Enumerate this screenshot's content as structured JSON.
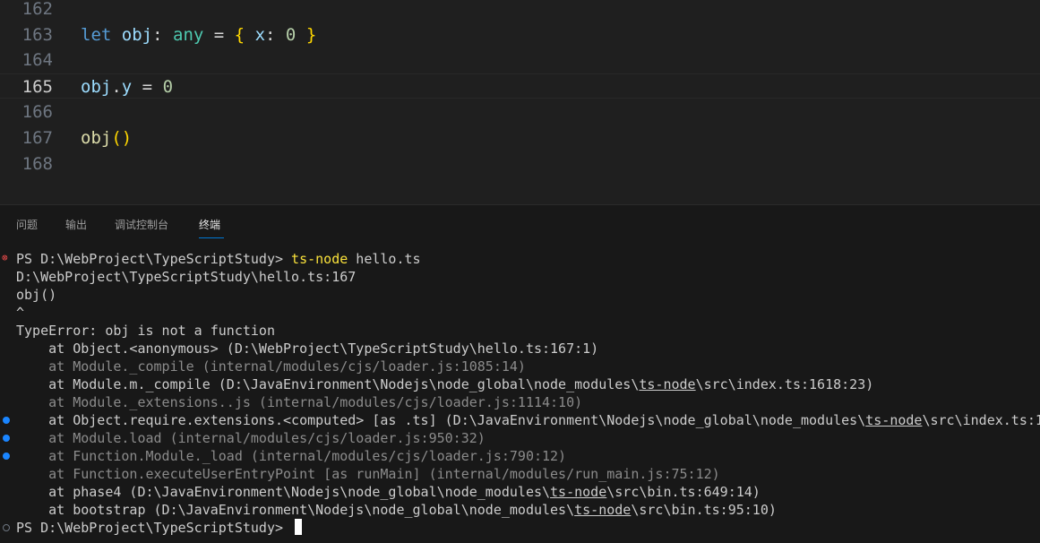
{
  "editor": {
    "lines": [
      {
        "num": "162",
        "tokens": []
      },
      {
        "num": "163",
        "tokens": [
          {
            "t": "let",
            "c": "kw"
          },
          {
            "t": " ",
            "c": "op"
          },
          {
            "t": "obj",
            "c": "var"
          },
          {
            "t": ": ",
            "c": "op"
          },
          {
            "t": "any",
            "c": "type"
          },
          {
            "t": " = ",
            "c": "op"
          },
          {
            "t": "{",
            "c": "brace"
          },
          {
            "t": " ",
            "c": "op"
          },
          {
            "t": "x",
            "c": "var"
          },
          {
            "t": ": ",
            "c": "op"
          },
          {
            "t": "0",
            "c": "num"
          },
          {
            "t": " ",
            "c": "op"
          },
          {
            "t": "}",
            "c": "brace"
          }
        ]
      },
      {
        "num": "164",
        "tokens": []
      },
      {
        "num": "165",
        "tokens": [
          {
            "t": "obj",
            "c": "var"
          },
          {
            "t": ".",
            "c": "op"
          },
          {
            "t": "y",
            "c": "var"
          },
          {
            "t": " = ",
            "c": "op"
          },
          {
            "t": "0",
            "c": "num"
          }
        ],
        "active": true
      },
      {
        "num": "166",
        "tokens": []
      },
      {
        "num": "167",
        "tokens": [
          {
            "t": "obj",
            "c": "fn"
          },
          {
            "t": "()",
            "c": "paren"
          }
        ]
      },
      {
        "num": "168",
        "tokens": []
      }
    ]
  },
  "panel": {
    "tabs": [
      {
        "label": "问题",
        "active": false
      },
      {
        "label": "输出",
        "active": false
      },
      {
        "label": "调试控制台",
        "active": false
      },
      {
        "label": "终端",
        "active": true
      }
    ]
  },
  "terminal": {
    "lines": [
      {
        "deco": "error",
        "segs": [
          {
            "t": "PS D:\\WebProject\\TypeScriptStudy> "
          },
          {
            "t": "ts-node",
            "c": "cmd"
          },
          {
            "t": " hello.ts"
          }
        ]
      },
      {
        "segs": [
          {
            "t": "D:\\WebProject\\TypeScriptStudy\\hello.ts:167"
          }
        ]
      },
      {
        "segs": [
          {
            "t": "obj()"
          }
        ]
      },
      {
        "segs": [
          {
            "t": "^"
          }
        ]
      },
      {
        "segs": [
          {
            "t": "TypeError: obj is not a function"
          }
        ]
      },
      {
        "segs": [
          {
            "t": "    at Object.<anonymous> (D:\\WebProject\\TypeScriptStudy\\hello.ts:167:1)"
          }
        ]
      },
      {
        "segs": [
          {
            "t": "    at Module._compile (internal/modules/cjs/loader.js:1085:14)",
            "c": "dim"
          }
        ]
      },
      {
        "segs": [
          {
            "t": "    at Module.m._compile (D:\\JavaEnvironment\\Nodejs\\node_global\\node_modules\\"
          },
          {
            "t": "ts-node",
            "c": "ul"
          },
          {
            "t": "\\src\\index.ts:1618:23)"
          }
        ]
      },
      {
        "segs": [
          {
            "t": "    at Module._extensions..js (internal/modules/cjs/loader.js:1114:10)",
            "c": "dim"
          }
        ]
      },
      {
        "deco": "dot",
        "segs": [
          {
            "t": "    at Object.require.extensions.<computed> [as .ts] (D:\\JavaEnvironment\\Nodejs\\node_global\\node_modules\\"
          },
          {
            "t": "ts-node",
            "c": "ul"
          },
          {
            "t": "\\src\\index.ts:1"
          }
        ]
      },
      {
        "deco": "dot",
        "segs": [
          {
            "t": "    at Module.load (internal/modules/cjs/loader.js:950:32)",
            "c": "dim"
          }
        ]
      },
      {
        "deco": "dot",
        "segs": [
          {
            "t": "    at Function.Module._load (internal/modules/cjs/loader.js:790:12)",
            "c": "dim"
          }
        ]
      },
      {
        "segs": [
          {
            "t": "    at Function.executeUserEntryPoint [as runMain] (internal/modules/run_main.js:75:12)",
            "c": "dim"
          }
        ]
      },
      {
        "segs": [
          {
            "t": "    at phase4 (D:\\JavaEnvironment\\Nodejs\\node_global\\node_modules\\"
          },
          {
            "t": "ts-node",
            "c": "ul"
          },
          {
            "t": "\\src\\bin.ts:649:14)"
          }
        ]
      },
      {
        "segs": [
          {
            "t": "    at bootstrap (D:\\JavaEnvironment\\Nodejs\\node_global\\node_modules\\"
          },
          {
            "t": "ts-node",
            "c": "ul"
          },
          {
            "t": "\\src\\bin.ts:95:10)"
          }
        ]
      },
      {
        "deco": "ring",
        "cursor": true,
        "segs": [
          {
            "t": "PS D:\\WebProject\\TypeScriptStudy> "
          }
        ]
      }
    ]
  }
}
